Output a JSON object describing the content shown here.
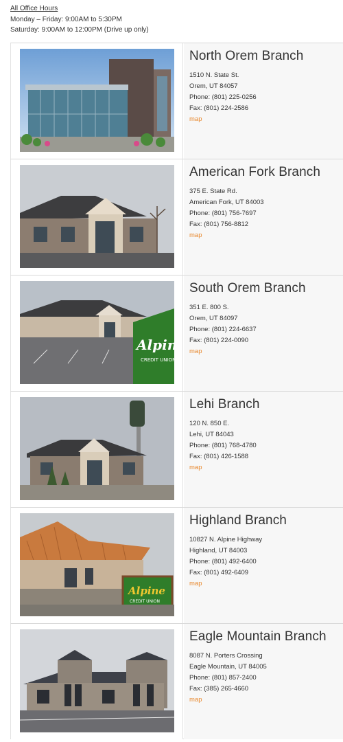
{
  "hours": {
    "header": "All Office Hours",
    "weekday": "Monday – Friday: 9:00AM to 5:30PM",
    "saturday": "Saturday: 9:00AM to 12:00PM (Drive up only)"
  },
  "branches": [
    {
      "name": "North Orem Branch",
      "street": "1510 N. State St.",
      "city": "Orem, UT 84057",
      "phone": "Phone: (801) 225-0256",
      "fax": "Fax: (801) 224-2586",
      "map": "map"
    },
    {
      "name": "American Fork Branch",
      "street": "375 E. State Rd.",
      "city": "American Fork, UT 84003",
      "phone": "Phone: (801) 756-7697",
      "fax": "Fax: (801) 756-8812",
      "map": "map"
    },
    {
      "name": "South Orem Branch",
      "street": "351 E. 800 S.",
      "city": "Orem, UT 84097",
      "phone": "Phone: (801) 224-6637",
      "fax": "Fax: (801) 224-0090",
      "map": "map"
    },
    {
      "name": "Lehi Branch",
      "street": "120 N. 850 E.",
      "city": "Lehi, UT 84043",
      "phone": "Phone: (801) 768-4780",
      "fax": "Fax: (801) 426-1588",
      "map": "map"
    },
    {
      "name": "Highland Branch",
      "street": "10827 N. Alpine Highway",
      "city": "Highland, UT 84003",
      "phone": "Phone: (801) 492-6400",
      "fax": "Fax: (801) 492-6409",
      "map": "map"
    },
    {
      "name": "Eagle Mountain Branch",
      "street": "8087 N. Porters Crossing",
      "city": "Eagle Mountain, UT 84005",
      "phone": "Phone: (801) 857-2400",
      "fax": "Fax: (385) 265-4660",
      "map": "map"
    }
  ],
  "signs": {
    "brand": "Alpine",
    "sub": "CREDIT UNION"
  },
  "colors": {
    "map_link": "#e8892f",
    "info_bg": "#f7f7f7",
    "sign_green": "#2f7d2a"
  }
}
